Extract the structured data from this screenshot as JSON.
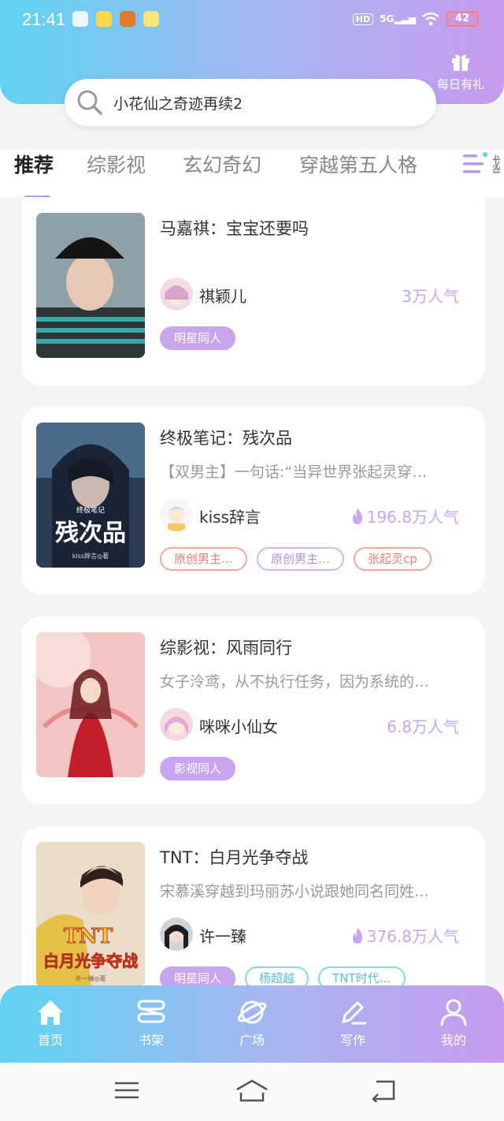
{
  "status_bar": {
    "time": "21:41",
    "network": "5G",
    "hd": "HD",
    "battery": "42"
  },
  "header": {
    "search_text": "小花仙之奇迹再续2",
    "gift_label": "每日有礼"
  },
  "tabs": [
    "推荐",
    "综影视",
    "玄幻奇幻",
    "穿越第五人格",
    "穿越"
  ],
  "books": [
    {
      "title": "马嘉祺：宝宝还要吗",
      "desc": "",
      "author": "祺颖儿",
      "popularity": "3万人气",
      "hot": false,
      "tags": [
        {
          "label": "明星同人",
          "style": "filled"
        }
      ]
    },
    {
      "title": "终极笔记：残次品",
      "desc": "【双男主】一句话:“当异世界张起灵穿…",
      "author": "kiss辞言",
      "popularity": "196.8万人气",
      "hot": true,
      "cover_text": {
        "series": "终极笔记",
        "title": "残次品",
        "author": "kiss辞言◎著"
      },
      "tags": [
        {
          "label": "原创男主…",
          "style": "red"
        },
        {
          "label": "原创男主…",
          "style": "purple"
        },
        {
          "label": "张起灵cp",
          "style": "red"
        }
      ]
    },
    {
      "title": "综影视：风雨同行",
      "desc": "女子泠鸢，从不执行任务，因为系统的…",
      "author": "咪咪小仙女",
      "popularity": "6.8万人气",
      "hot": false,
      "tags": [
        {
          "label": "影视同人",
          "style": "filled"
        }
      ]
    },
    {
      "title": "TNT：白月光争夺战",
      "desc": "宋慕溪穿越到玛丽苏小说跟她同名同姓…",
      "author": "许一臻",
      "popularity": "376.8万人气",
      "hot": true,
      "cover_text": {
        "series": "TNT",
        "title": "白月光争夺战",
        "author": "许一臻◎著"
      },
      "tags": [
        {
          "label": "明星同人",
          "style": "filled"
        },
        {
          "label": "杨超越",
          "style": "cyan"
        },
        {
          "label": "TNT时代…",
          "style": "cyan"
        }
      ]
    }
  ],
  "bottom_nav": [
    "首页",
    "书架",
    "广场",
    "写作",
    "我的"
  ],
  "colors": {
    "gradient_start": "#5ed3f2",
    "gradient_end": "#c79bee",
    "popularity": "#c7a6f4",
    "tag_fill": "#c8a5ee"
  }
}
